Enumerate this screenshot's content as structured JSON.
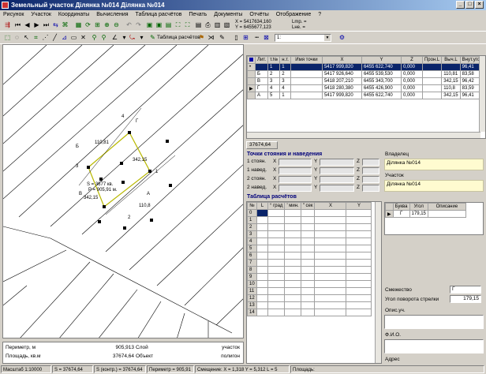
{
  "window": {
    "title": "Земельный участок   Ділянка №014   Ділянка №014"
  },
  "menu": [
    "Рисунок",
    "Участок",
    "Координаты",
    "Вычисления",
    "Таблица расчётов",
    "Печать",
    "Документы",
    "Отчёты",
    "Отображение",
    "?"
  ],
  "coords": {
    "x": "X = 5417634,160",
    "y": "Y = 6455677,123",
    "lmp": "Lmp. =",
    "lhe": "Lнe. ="
  },
  "toolbar3": {
    "table_label": "Таблица расчётов",
    "scale_select": "1:"
  },
  "map_labels": {
    "s": "S = 3677 кв.",
    "p": "P = 905,91 м.",
    "a": "А",
    "b": "Б",
    "v": "В",
    "g": "Г",
    "d1": "342,15",
    "d2": "342,15",
    "d3": "110,81",
    "d4": "110,8",
    "n1": "1",
    "n2": "2",
    "n3": "3",
    "n4": "4"
  },
  "points_table": {
    "headers": [
      "",
      "Лит.",
      "т.№",
      "н.т.",
      "Имя точки",
      "X",
      "Y",
      "Z",
      "Прон.L",
      "Выч.L",
      "Внут.угол"
    ],
    "rows": [
      [
        "",
        "",
        "1",
        "1",
        "",
        "5417 999,820",
        "6455 622,740",
        "0,000",
        "",
        "",
        "96,41"
      ],
      [
        "",
        "Б",
        "2",
        "2",
        "",
        "5417 926,640",
        "6455 539,530",
        "0,000",
        "",
        "110,81",
        "83,58"
      ],
      [
        "",
        "В",
        "3",
        "3",
        "",
        "5418 207,210",
        "6455 343,700",
        "0,000",
        "",
        "342,15",
        "96,42"
      ],
      [
        "",
        "Г",
        "4",
        "4",
        "",
        "5418 280,380",
        "6455 426,900",
        "0,000",
        "",
        "110,8",
        "83,59"
      ],
      [
        "",
        "А",
        "5",
        "1",
        "",
        "5417 999,820",
        "6455 622,740",
        "0,000",
        "",
        "342,15",
        "96,41"
      ]
    ]
  },
  "tab_label": "37674,64",
  "stations": {
    "title": "Точки стояния и наведения",
    "rows": [
      {
        "label": "1 стоян.",
        "x": "X",
        "y": "Y",
        "z": "Z"
      },
      {
        "label": "1 навед.",
        "x": "X",
        "y": "Y",
        "z": "Z"
      },
      {
        "label": "2 стоян.",
        "x": "X",
        "y": "Y",
        "z": "Z"
      },
      {
        "label": "2 навед.",
        "x": "X",
        "y": "Y",
        "z": "Z"
      }
    ]
  },
  "owner": {
    "label": "Владелец",
    "value": "Ділянка №014"
  },
  "parcel": {
    "label": "Участок",
    "value": "Ділянка №014"
  },
  "calc": {
    "title": "Таблица расчётов",
    "headers": [
      "№",
      "L",
      "° град",
      "' мин.",
      "\" сек",
      "X",
      "Y"
    ],
    "row_numbers": [
      "0",
      "1",
      "2",
      "3",
      "4",
      "5",
      "6",
      "7",
      "8",
      "9",
      "10",
      "11",
      "12",
      "13",
      "14"
    ]
  },
  "angle_table": {
    "headers": [
      "Буква",
      "Угол",
      "Описание"
    ],
    "rows": [
      [
        "Г",
        "179,15",
        ""
      ]
    ]
  },
  "fields": {
    "neighbor_label": "Смежество",
    "neighbor_value": "Г",
    "arrow_label": "Угол поворота стрелки",
    "arrow_value": "179,15",
    "desc_label": "Опис.уч.",
    "fio_label": "Ф.И.О.",
    "address_label": "Адрес"
  },
  "info": {
    "perimeter_label": "Периметр, м",
    "perimeter_value": "905,913",
    "layer_label": "Слой",
    "layer_value": "участок",
    "area_label": "Площадь, кв.м",
    "area_value": "37674,64",
    "object_label": "Объект",
    "object_value": "полигон"
  },
  "status": {
    "scale": "Масштаб 1:10000",
    "s": "S = 37674,64",
    "s_control": "S (контр.) = 37674,64",
    "perimeter": "Периметр = 905,91",
    "offset": "Смещение: X = 1,318 Y = 5,312 L = 5",
    "area": "Площадь:"
  }
}
